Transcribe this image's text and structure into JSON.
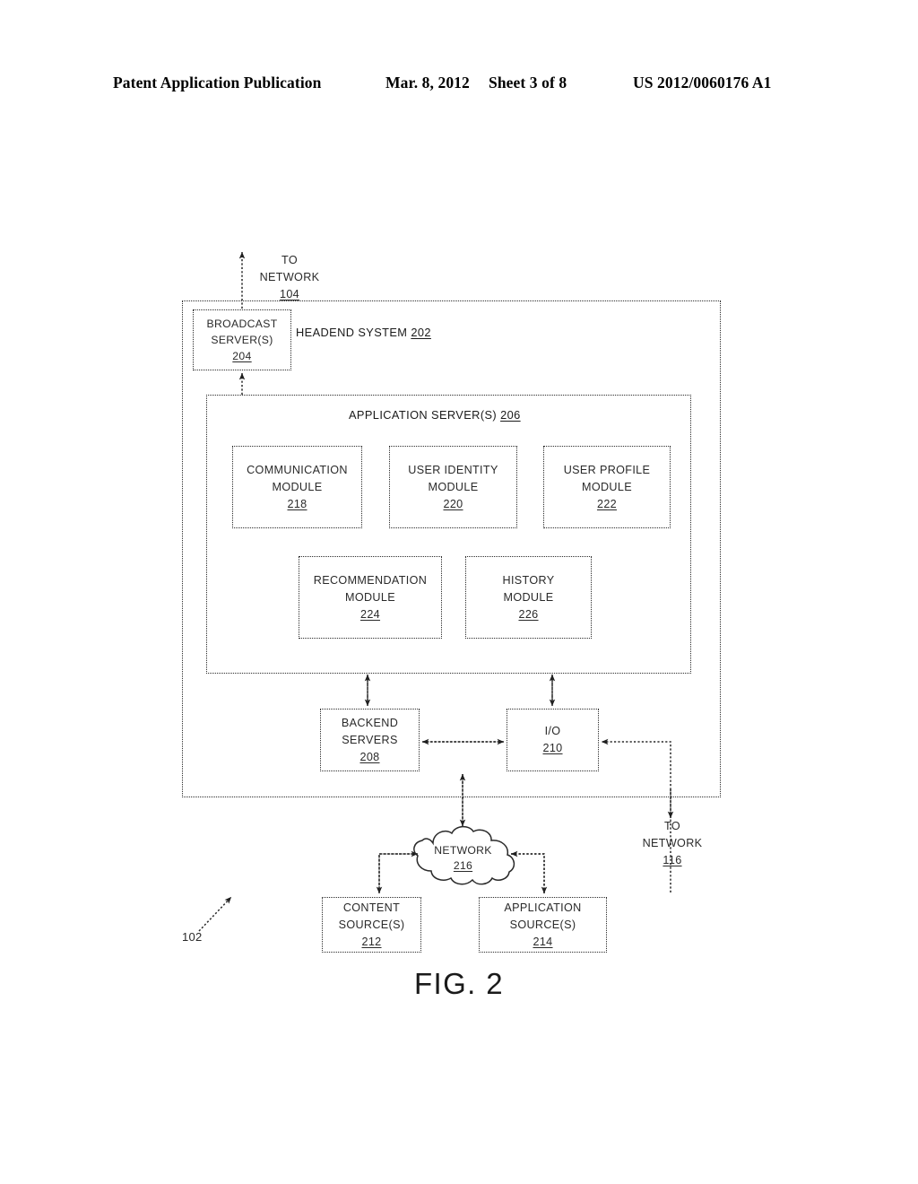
{
  "header": {
    "publication": "Patent Application Publication",
    "date": "Mar. 8, 2012",
    "sheet": "Sheet 3 of 8",
    "patent_number": "US 2012/0060176 A1"
  },
  "figure": {
    "caption": "FIG. 2",
    "system_ref": "102",
    "top_label": {
      "line1": "TO",
      "line2": "NETWORK",
      "ref": "104"
    },
    "right_label": {
      "line1": "TO",
      "line2": "NETWORK",
      "ref": "116"
    },
    "headend": {
      "title": "HEADEND SYSTEM",
      "ref": "202"
    },
    "broadcast_server": {
      "line1": "BROADCAST",
      "line2": "SERVER(S)",
      "ref": "204"
    },
    "application_server": {
      "title": "APPLICATION SERVER(S)",
      "ref": "206",
      "modules": [
        {
          "line1": "COMMUNICATION",
          "line2": "MODULE",
          "ref": "218"
        },
        {
          "line1": "USER IDENTITY",
          "line2": "MODULE",
          "ref": "220"
        },
        {
          "line1": "USER PROFILE",
          "line2": "MODULE",
          "ref": "222"
        },
        {
          "line1": "RECOMMENDATION",
          "line2": "MODULE",
          "ref": "224"
        },
        {
          "line1": "HISTORY",
          "line2": "MODULE",
          "ref": "226"
        }
      ]
    },
    "backend_servers": {
      "line1": "BACKEND",
      "line2": "SERVERS",
      "ref": "208"
    },
    "io": {
      "line1": "I/O",
      "line2": "",
      "ref": "210"
    },
    "network_cloud": {
      "label": "NETWORK",
      "ref": "216"
    },
    "content_sources": {
      "line1": "CONTENT",
      "line2": "SOURCE(S)",
      "ref": "212"
    },
    "application_sources": {
      "line1": "APPLICATION",
      "line2": "SOURCE(S)",
      "ref": "214"
    }
  },
  "style": {
    "ink": "#2a2a2a",
    "paper": "#ffffff"
  }
}
